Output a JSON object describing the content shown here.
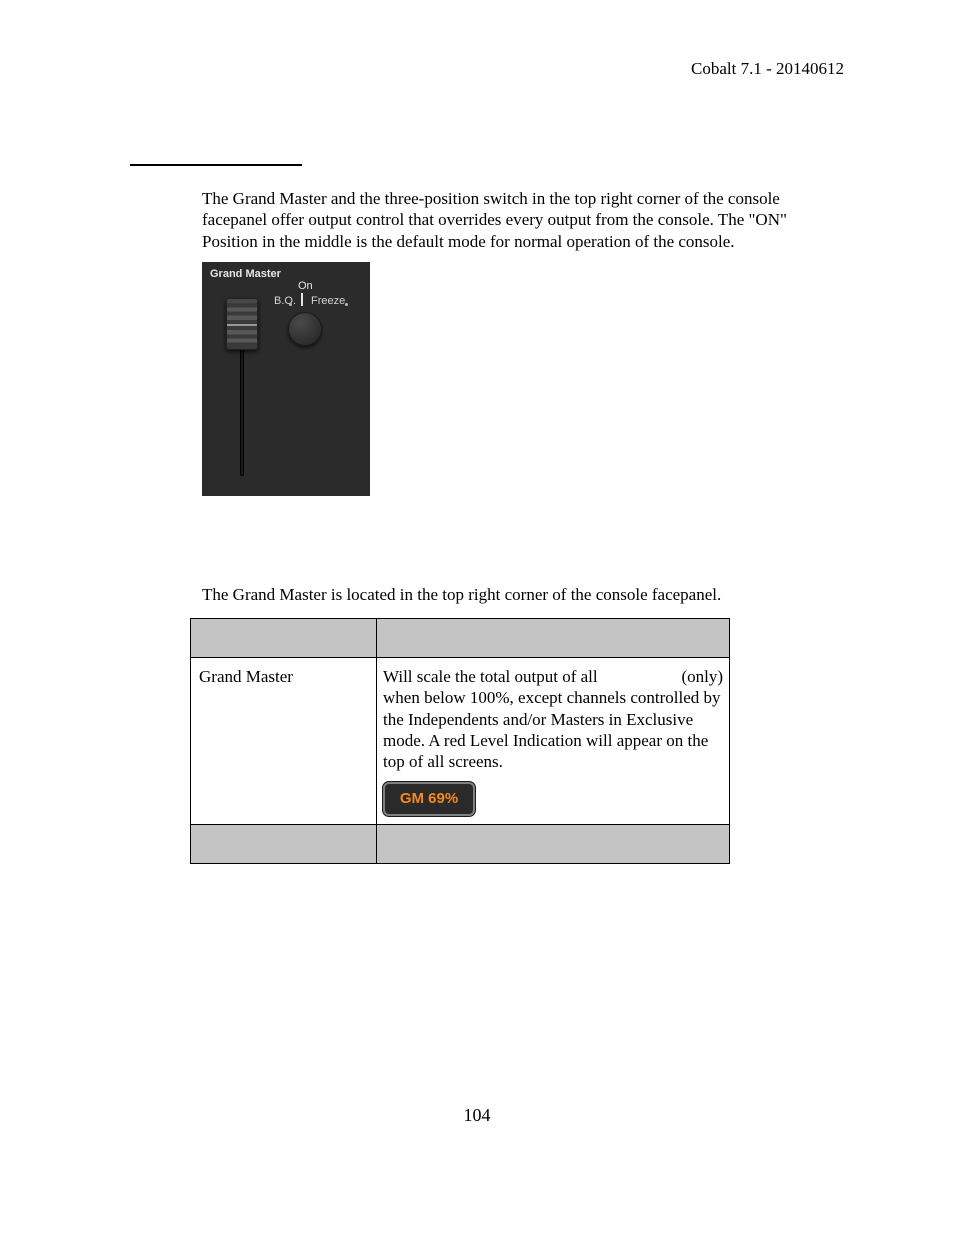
{
  "header": {
    "running_head": "Cobalt 7.1 - 20140612"
  },
  "intro_paragraph": "The Grand Master and the three-position switch in the top right corner of the console facepanel offer output control that overrides every output from the console. The \"ON\" Position in the middle is the default mode for normal operation of the console.",
  "panel": {
    "title": "Grand Master",
    "switch_on": "On",
    "switch_bo": "B.O.",
    "switch_freeze": "Freeze"
  },
  "subsection_paragraph": "The Grand Master is located in the top right corner of the console facepanel.",
  "function_table": {
    "rows": [
      {
        "name": "Grand Master",
        "desc_prefix": "Will scale the total output of all",
        "desc_suffix": "(only)",
        "desc_rest": "when below 100%, except channels controlled by the Independents and/or Masters in Exclusive mode. A red Level Indication will appear on the top of all screens.",
        "badge": "GM 69%"
      }
    ]
  },
  "page_number": "104"
}
